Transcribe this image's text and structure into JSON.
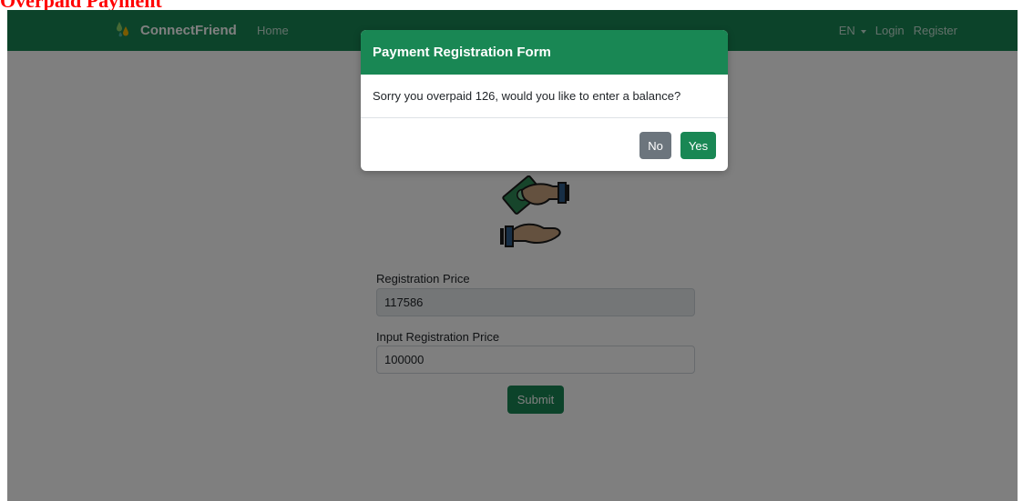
{
  "caption": "Overpaid Payment",
  "navbar": {
    "brand": "ConnectFriend",
    "home": "Home",
    "language": "EN",
    "login": "Login",
    "register": "Register"
  },
  "form": {
    "icon": "hands-exchanging-money-icon",
    "registration_price_label": "Registration Price",
    "registration_price_value": "117586",
    "input_price_label": "Input Registration Price",
    "input_price_value": "100000",
    "submit_label": "Submit"
  },
  "modal": {
    "title": "Payment Registration Form",
    "message": "Sorry you overpaid 126, would you like to enter a balance?",
    "no_label": "No",
    "yes_label": "Yes"
  },
  "colors": {
    "primary_green": "#198754",
    "secondary_gray": "#6c757d",
    "caption_red": "#ff0000"
  }
}
